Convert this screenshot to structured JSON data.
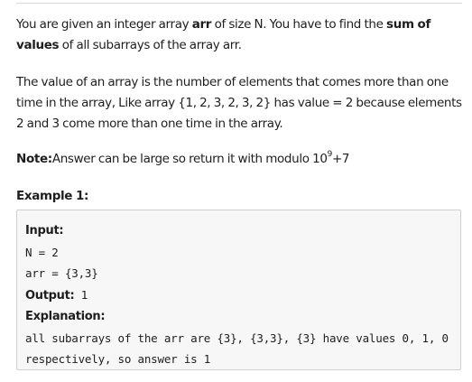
{
  "problem": {
    "intro": {
      "t1": "You are given an integer array ",
      "b1": "arr",
      "t2": " of size N. You have to find the ",
      "b2": "sum of values",
      "t3": " of all subarrays of the array arr."
    },
    "value_def": "The value of an array is the number of elements that comes more than one time in the array, Like array {1, 2, 3, 2, 3, 2} has value = 2 because elements 2 and 3 come more than one time in the array.",
    "note": {
      "label": "Note:",
      "text": "Answer can be large so return it with modulo 10",
      "exponent": "9",
      "suffix": "+7"
    },
    "example_title": "Example 1:"
  },
  "example": {
    "input_label": "Input:",
    "n_line": "N = 2",
    "arr_line": "arr = {3,3}",
    "output_label": "Output:",
    "output_value": " 1",
    "explanation_label": "Explanation:",
    "explanation_line1": "all subarrays of the arr are {3}, {3,3}, {3} have values 0, 1, 0",
    "explanation_line2": "respectively, so answer is 1"
  }
}
